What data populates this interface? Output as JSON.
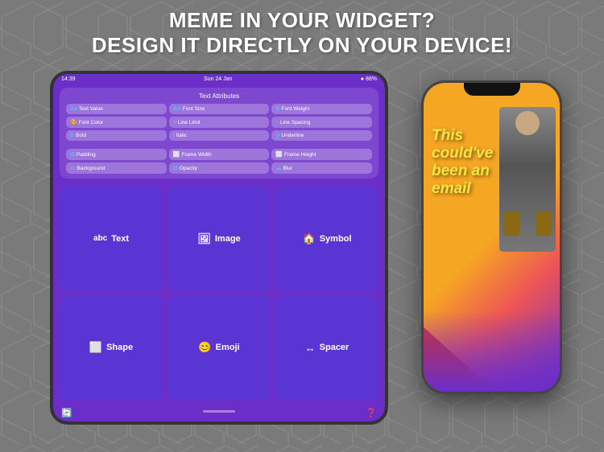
{
  "header": {
    "line1": "MEME IN YOUR WIDGET?",
    "line2": "DESIGN IT DIRECTLY ON YOUR DEVICE!"
  },
  "ipad": {
    "status_bar": {
      "time": "14:39",
      "date": "Sun 24 Jan",
      "battery": "● 88%"
    },
    "panel": {
      "title": "Text Attributes",
      "attributes": [
        {
          "icon": "Aa",
          "label": "Text Value"
        },
        {
          "icon": "AA",
          "label": "Font Size"
        },
        {
          "icon": "B",
          "label": "Font Weight"
        },
        {
          "icon": "🎨",
          "label": "Font Color"
        },
        {
          "icon": "≡",
          "label": "Line Limit"
        },
        {
          "icon": "↕",
          "label": "Line Spacing"
        },
        {
          "icon": "B",
          "label": "Bold"
        },
        {
          "icon": "I",
          "label": "Italic"
        },
        {
          "icon": "U",
          "label": "Underline"
        },
        {
          "icon": "⊞",
          "label": "Padding"
        },
        {
          "icon": "⬜",
          "label": "Frame Width"
        },
        {
          "icon": "⬜",
          "label": "Frame Height"
        },
        {
          "icon": "▭",
          "label": "Background"
        },
        {
          "icon": "◎",
          "label": "Opacity"
        },
        {
          "icon": "☁",
          "label": "Blur"
        }
      ]
    },
    "buttons": [
      {
        "icon": "abc",
        "label": "Text"
      },
      {
        "icon": "🖼",
        "label": "Image"
      },
      {
        "icon": "🏠",
        "label": "Symbol"
      },
      {
        "icon": "⬜",
        "label": "Shape"
      },
      {
        "icon": "😊",
        "label": "Emoji"
      },
      {
        "icon": "↔",
        "label": "Spacer"
      }
    ],
    "bottom_icons": {
      "left": "🔄",
      "right": "❓"
    }
  },
  "iphone": {
    "meme_text": "This could've been an email"
  }
}
